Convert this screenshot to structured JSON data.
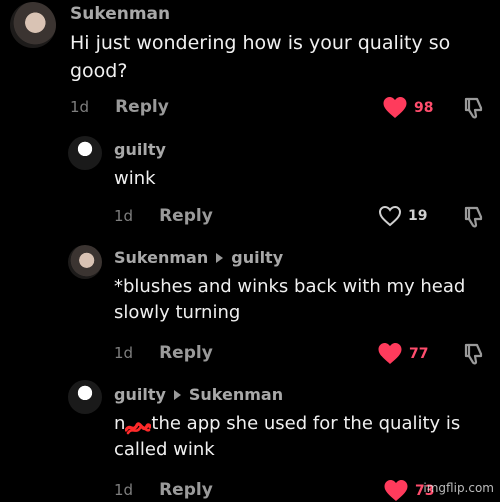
{
  "comments": [
    {
      "author": "Sukenman",
      "reply_to": "",
      "text": "Hi just wondering how is your quality so good?",
      "age": "1d",
      "reply_label": "Reply",
      "likes": "98",
      "liked": true
    },
    {
      "author": "guilty",
      "reply_to": "",
      "text": "wink",
      "age": "1d",
      "reply_label": "Reply",
      "likes": "19",
      "liked": false
    },
    {
      "author": "Sukenman",
      "reply_to": "guilty",
      "text": "*blushes and winks back with my head slowly turning",
      "age": "1d",
      "reply_label": "Reply",
      "likes": "77",
      "liked": true
    },
    {
      "author": "guilty",
      "reply_to": "Sukenman",
      "text_before": "n",
      "text_after": "the app she used for the quality is called wink",
      "age": "1d",
      "reply_label": "Reply",
      "likes": "73",
      "liked": true
    }
  ],
  "icons": {
    "like": "heart-icon",
    "dislike": "thumbs-down-icon",
    "reply_arrow": "reply-arrow-icon"
  },
  "colors": {
    "liked_heart": "#ff3b5c",
    "unliked_heart": "#d0d0d0",
    "background": "#000000"
  },
  "watermark": "imgflip.com"
}
